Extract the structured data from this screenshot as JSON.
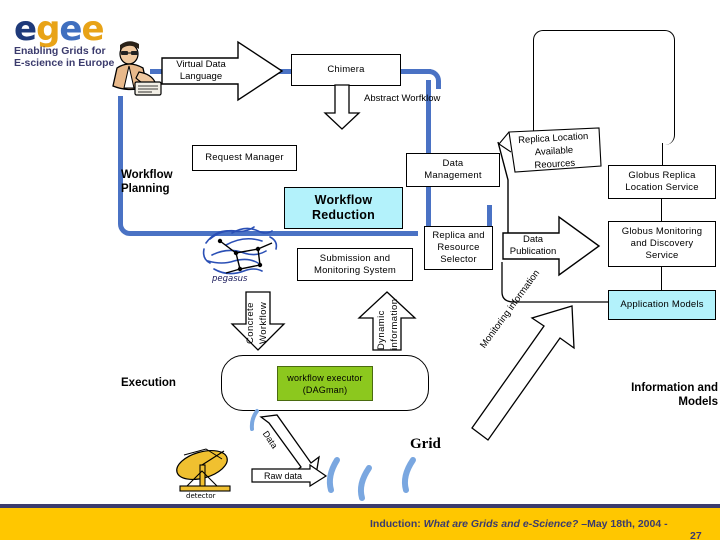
{
  "slide": {
    "logo": {
      "word": "egee",
      "tagline_line1": "Enabling Grids for",
      "tagline_line2": "E-science in Europe"
    },
    "footer": {
      "prefix": "Induction:",
      "title": "What are Grids and e-Science?",
      "date": "–May 18th, 2004  -",
      "page": "27",
      "rule_color": "#3b3b6d",
      "bar_color": "#ffc700"
    }
  },
  "captions": {
    "workflow_planning": "Workflow\nPlanning",
    "execution": "Execution",
    "grid": "Grid",
    "information_models": "Information and\nModels"
  },
  "nodes": {
    "virtual_data_language": "Virtual Data\nLanguage",
    "chimera": "Chimera",
    "abstract_workflow": "Abstract Worfklow",
    "request_manager": "Request Manager",
    "workflow_reduction": "Workflow\nReduction",
    "submission_monitoring": "Submission  and\nMonitoring System",
    "data_management": "Data\nManagement",
    "replica_resource_selector": "Replica and\nResource\nSelector",
    "replica_location_available": "Replica Location\nAvailable\nReources",
    "data_publication": "Data\nPublication",
    "globus_replica_location": "Globus Replica\nLocation Service",
    "globus_monitoring": "Globus Monitoring\nand Discovery\nService",
    "application_models": "Application Models",
    "workflow_executor": "workflow executor\n(DAGman)",
    "concrete_workflow": "Concrete\nWorkflow",
    "dynamic_information": "Dynamic\ninformation",
    "monitoring_information": "Monitoring information",
    "raw_data": "Raw data",
    "data_label": "Data",
    "detector": "detector",
    "pegasus": "pegasus"
  },
  "colors": {
    "flow_blue": "#4a72c4",
    "highlight_cyan": "#b3f2fb",
    "executor_green": "#8cc81e",
    "accent_gold": "#ffc700",
    "ink": "#000000"
  }
}
